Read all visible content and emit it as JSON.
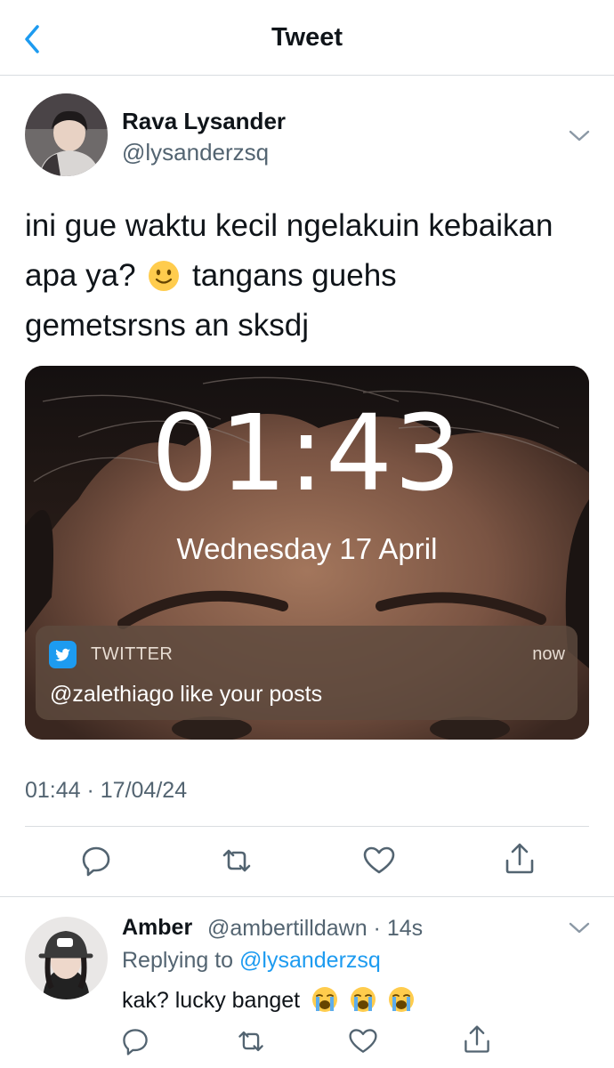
{
  "header": {
    "title": "Tweet"
  },
  "tweet": {
    "author_name": "Rava Lysander",
    "author_handle": "@lysanderzsq",
    "text_line1": "ini gue waktu kecil ngelakuin kebaikan",
    "text_line2_a": "apa ya?",
    "text_line2_b": "tangans guehs",
    "text_line3": "gemetsrsns an sksdj",
    "timestamp": "01:44 · 17/04/24",
    "media": {
      "time": "01:43",
      "date": "Wednesday 17 April",
      "notification": {
        "app": "TWITTER",
        "time": "now",
        "body": "@zalethiago like your posts"
      }
    }
  },
  "reply": {
    "name": "Amber",
    "handle_time": "@ambertilldawn · 14s",
    "replying_prefix": "Replying to",
    "replying_handle": "@lysanderzsq",
    "text": "kak? lucky banget"
  },
  "icons": {
    "back": "chevron-left-icon",
    "more": "chevron-down-icon",
    "reply": "reply-icon",
    "retweet": "retweet-icon",
    "like": "heart-icon",
    "share": "share-icon"
  },
  "colors": {
    "accent": "#1d9bf0",
    "secondary_text": "#536471",
    "divider": "#d9dde1"
  }
}
